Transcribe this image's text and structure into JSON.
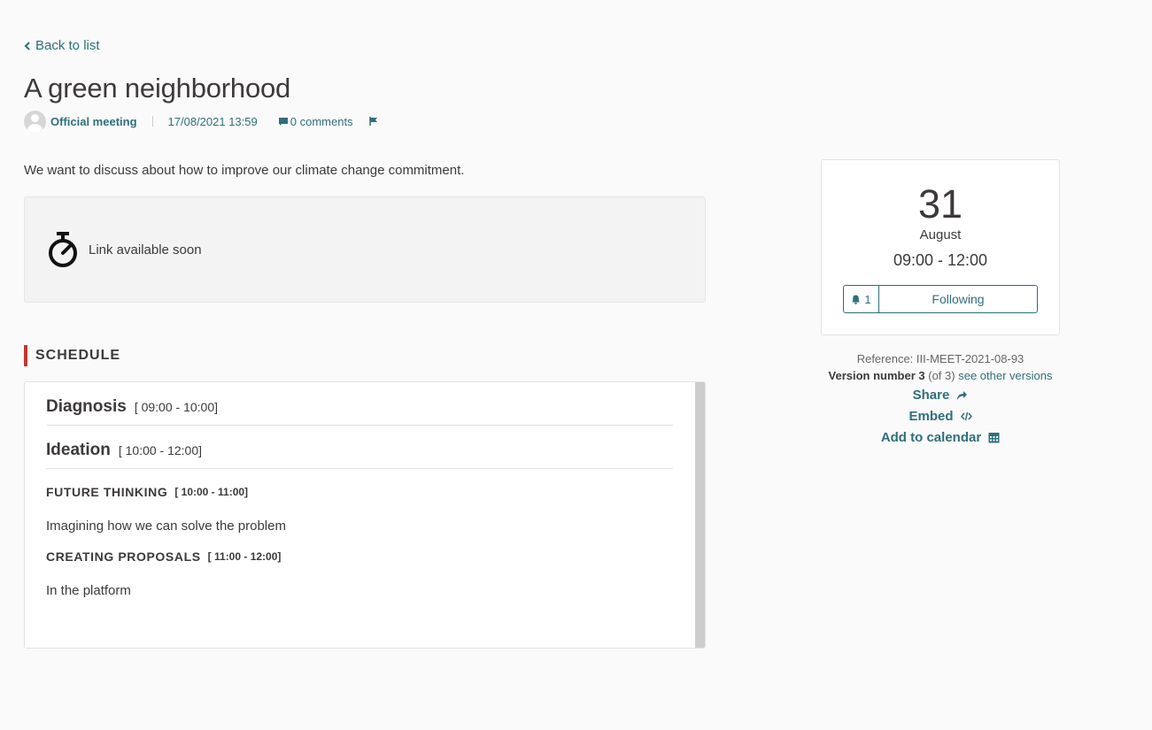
{
  "back": {
    "label": "Back to list"
  },
  "meeting": {
    "title": "A green neighborhood",
    "author": "Official meeting",
    "date": "17/08/2021 13:59",
    "comments": "0 comments",
    "description": "We want to discuss about how to improve our climate change commitment.",
    "link_status": "Link available soon"
  },
  "schedule": {
    "heading": "SCHEDULE",
    "items": [
      {
        "title": "Diagnosis",
        "time": "[ 09:00 - 10:00]"
      },
      {
        "title": "Ideation",
        "time": "[ 10:00 - 12:00]"
      }
    ],
    "subitems": [
      {
        "title": "FUTURE THINKING",
        "time": "[ 10:00 - 11:00]",
        "description": "Imagining how we can solve the problem"
      },
      {
        "title": "CREATING PROPOSALS",
        "time": "[ 11:00 - 12:00]",
        "description": "In the platform"
      }
    ]
  },
  "card": {
    "day": "31",
    "month": "August",
    "hours": "09:00 - 12:00",
    "followers": "1",
    "follow_label": "Following"
  },
  "side": {
    "reference": "Reference: III-MEET-2021-08-93",
    "version_bold": "Version number 3",
    "version_of": "(of 3)",
    "versions_link": "see other versions",
    "share": "Share",
    "embed": "Embed",
    "calendar": "Add to calendar"
  },
  "colors": {
    "accent": "#2f6f7a",
    "heading_bar": "#c0392b",
    "text": "#3d393c"
  },
  "icons": [
    "chevron-left-icon",
    "avatar-icon",
    "comment-icon",
    "flag-icon",
    "stopwatch-icon",
    "bell-icon",
    "share-icon",
    "code-icon",
    "calendar-icon"
  ]
}
